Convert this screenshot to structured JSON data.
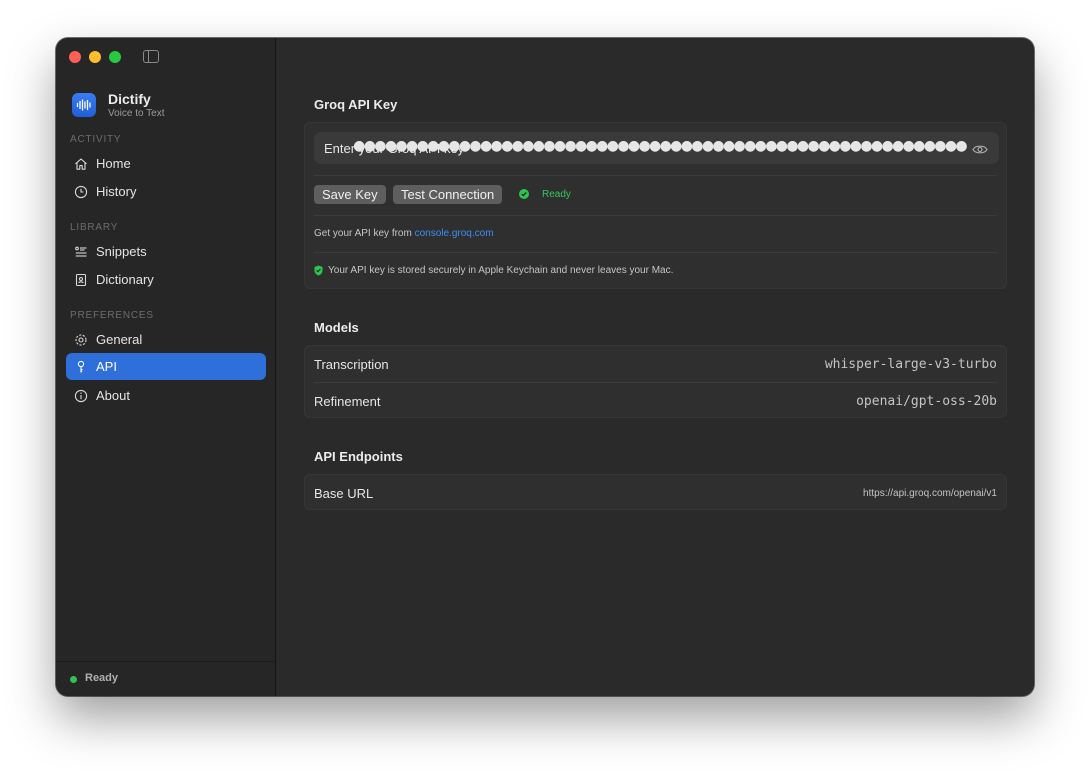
{
  "app": {
    "name": "Dictify",
    "subtitle": "Voice to Text",
    "logo_icon": "waveform-icon",
    "accent_color": "#2e6fd9",
    "status_color": "#34c759"
  },
  "sidebar": {
    "sections": [
      {
        "label": "ACTIVITY",
        "items": [
          {
            "label": "Home",
            "icon": "house-icon",
            "active": false
          },
          {
            "label": "History",
            "icon": "clock-icon",
            "active": false
          }
        ]
      },
      {
        "label": "LIBRARY",
        "items": [
          {
            "label": "Snippets",
            "icon": "list-icon",
            "active": false
          },
          {
            "label": "Dictionary",
            "icon": "book-icon",
            "active": false
          }
        ]
      },
      {
        "label": "PREFERENCES",
        "items": [
          {
            "label": "General",
            "icon": "gear-icon",
            "active": false
          },
          {
            "label": "API",
            "icon": "key-icon",
            "active": true
          },
          {
            "label": "About",
            "icon": "info-icon",
            "active": false
          }
        ]
      }
    ],
    "footer_status": "Ready"
  },
  "api_key": {
    "heading": "Groq API Key",
    "field_label": "Enter your Groq API key",
    "masked_value": "●●●●●●●●●●●●●●●●●●●●●●●●●●●●●●●●●●●●●●●●●●●●●●●●●●●●●●●●●●",
    "save_button": "Save Key",
    "test_button": "Test Connection",
    "connection_status": "Ready",
    "help_prefix": "Get your API key from ",
    "help_link": "console.groq.com",
    "security_note": "Your API key is stored securely in Apple Keychain and never leaves your Mac."
  },
  "models": {
    "heading": "Models",
    "rows": [
      {
        "label": "Transcription",
        "value": "whisper-large-v3-turbo"
      },
      {
        "label": "Refinement",
        "value": "openai/gpt-oss-20b"
      }
    ]
  },
  "endpoints": {
    "heading": "API Endpoints",
    "rows": [
      {
        "label": "Base URL",
        "value": "https://api.groq.com/openai/v1"
      }
    ]
  }
}
